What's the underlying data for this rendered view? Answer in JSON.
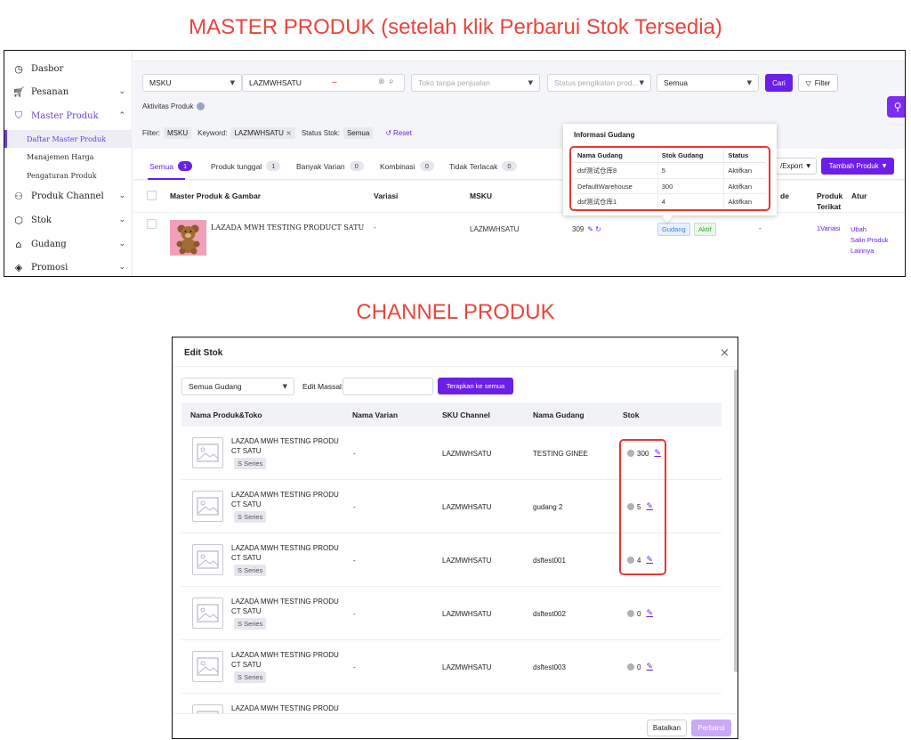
{
  "headings": {
    "master": "MASTER PRODUK (setelah klik Perbarui Stok Tersedia)",
    "channel": "CHANNEL PRODUK"
  },
  "master": {
    "sidebar": {
      "items": [
        {
          "label": "Dasbor",
          "icon": "dashboard-icon"
        },
        {
          "label": "Pesanan",
          "icon": "cart-icon"
        },
        {
          "label": "Master Produk",
          "icon": "bag-icon"
        },
        {
          "label": "Produk Channel",
          "icon": "channel-icon"
        },
        {
          "label": "Stok",
          "icon": "box-icon"
        },
        {
          "label": "Gudang",
          "icon": "warehouse-icon"
        },
        {
          "label": "Promosi",
          "icon": "tag-icon"
        }
      ],
      "sub_items": [
        "Daftar Master Produk",
        "Manajemen Harga",
        "Pengaturan Produk"
      ]
    },
    "search": {
      "field": "MSKU",
      "keyword": "LAZMWHSATU",
      "channel_placeholder": "Toko tanpa penjualan",
      "status_placeholder": "Status pengikatan prod...",
      "all": "Semua",
      "search_button": "Cari",
      "filter_button": "Filter"
    },
    "activity": "Aktivitas Produk",
    "filter_bar": {
      "filter_label": "Filter:",
      "filter_value": "MSKU",
      "keyword_label": "Keyword:",
      "keyword_value": "LAZMWHSATU",
      "status_label": "Status Stok:",
      "status_value": "Semua",
      "reset": "Reset"
    },
    "tabs": [
      {
        "label": "Semua",
        "count": "1"
      },
      {
        "label": "Produk tunggal",
        "count": "1"
      },
      {
        "label": "Banyak Varian",
        "count": "0"
      },
      {
        "label": "Kombinasi",
        "count": "0"
      },
      {
        "label": "Tidak Terlacak",
        "count": "0"
      }
    ],
    "export_button": "/Export",
    "add_button": "Tambah Produk",
    "columns": {
      "product": "Master Produk & Gambar",
      "variant": "Variasi",
      "msku": "MSKU",
      "de": "de",
      "bound_1": "Produk",
      "bound_2": "Terikat",
      "action": "Atur"
    },
    "row": {
      "name": "LAZADA MWH TESTING PRODUCT SATU",
      "variant": "-",
      "msku": "LAZMWHSATU",
      "stock": "309",
      "warehouse_tag": "Gudang",
      "active_tag": "Aktif",
      "dash": "-",
      "bound": "1Variasi",
      "actions": [
        "Ubah",
        "Salin Produk",
        "Lainnya"
      ]
    },
    "popover": {
      "title": "Informasi Gudang",
      "headers": [
        "Nama Gudang",
        "Stok Gudang",
        "Status"
      ],
      "rows": [
        [
          "dsf测试仓库8",
          "5",
          "Aktifkan"
        ],
        [
          "DefaultWarehouse",
          "300",
          "Aktifkan"
        ],
        [
          "dsf测试仓库1",
          "4",
          "Aktifkan"
        ]
      ]
    }
  },
  "channel": {
    "title": "Edit Stok",
    "warehouse_select": "Semua Gudang",
    "mass_edit_label": "Edit Massal:",
    "apply_button": "Terapkan ke semua",
    "columns": [
      "Nama Produk&Toko",
      "Nama Varian",
      "SKU Channel",
      "Nama Gudang",
      "Stok"
    ],
    "product_line1": "LAZADA MWH TESTING PRODU",
    "product_line2": "CT SATU",
    "series": "S Series",
    "rows": [
      {
        "variant": "-",
        "sku": "LAZMWHSATU",
        "warehouse": "TESTING GINEE",
        "stock": "300"
      },
      {
        "variant": "-",
        "sku": "LAZMWHSATU",
        "warehouse": "gudang 2",
        "stock": "5"
      },
      {
        "variant": "-",
        "sku": "LAZMWHSATU",
        "warehouse": "dsftest001",
        "stock": "4"
      },
      {
        "variant": "-",
        "sku": "LAZMWHSATU",
        "warehouse": "dsftest002",
        "stock": "0"
      },
      {
        "variant": "-",
        "sku": "LAZMWHSATU",
        "warehouse": "dsftest003",
        "stock": "0"
      }
    ],
    "cancel_button": "Batalkan",
    "update_button": "Perbarui"
  },
  "colors": {
    "accent": "#6b1fe8",
    "highlight": "#e53935",
    "heading": "#e8453c"
  }
}
